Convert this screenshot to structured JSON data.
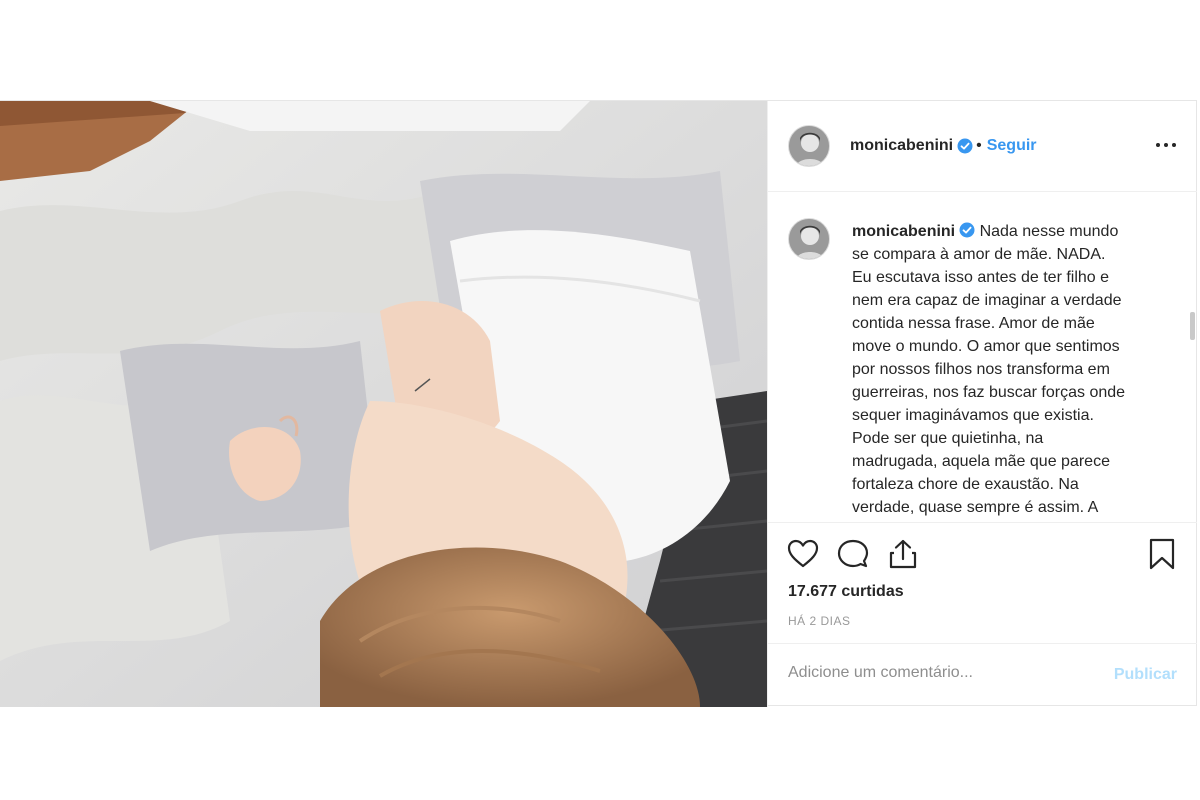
{
  "post": {
    "username": "monicabenini",
    "follow_label": "Seguir",
    "separator": "•",
    "caption_username": "monicabenini",
    "caption_text": "Nada nesse mundo\nse compara à amor de mãe. NADA.\nEu escutava isso antes de ter filho e\nnem era capaz de imaginar a verdade\ncontida nessa frase. Amor de mãe\nmove o mundo. O amor que sentimos\npor nossos filhos nos transforma em\nguerreiras, nos faz buscar forças onde\nsequer imaginávamos que existia.\nPode ser que quietinha, na\nmadrugada, aquela mãe que parece\nfortaleza chore de exaustão. Na\nverdade, quase sempre é assim. A",
    "likes": "17.677 curtidas",
    "time": "HÁ 2 DIAS",
    "comment_placeholder": "Adicione um comentário...",
    "publish_label": "Publicar"
  },
  "icons": {
    "verified": "verified-badge-icon",
    "more": "more-options-icon",
    "like": "heart-icon",
    "comment": "comment-icon",
    "share": "share-icon",
    "save": "bookmark-icon"
  },
  "colors": {
    "accent": "#3897f0",
    "publish_disabled": "#b2dffc",
    "text": "#262626",
    "muted": "#8e8e8e"
  }
}
